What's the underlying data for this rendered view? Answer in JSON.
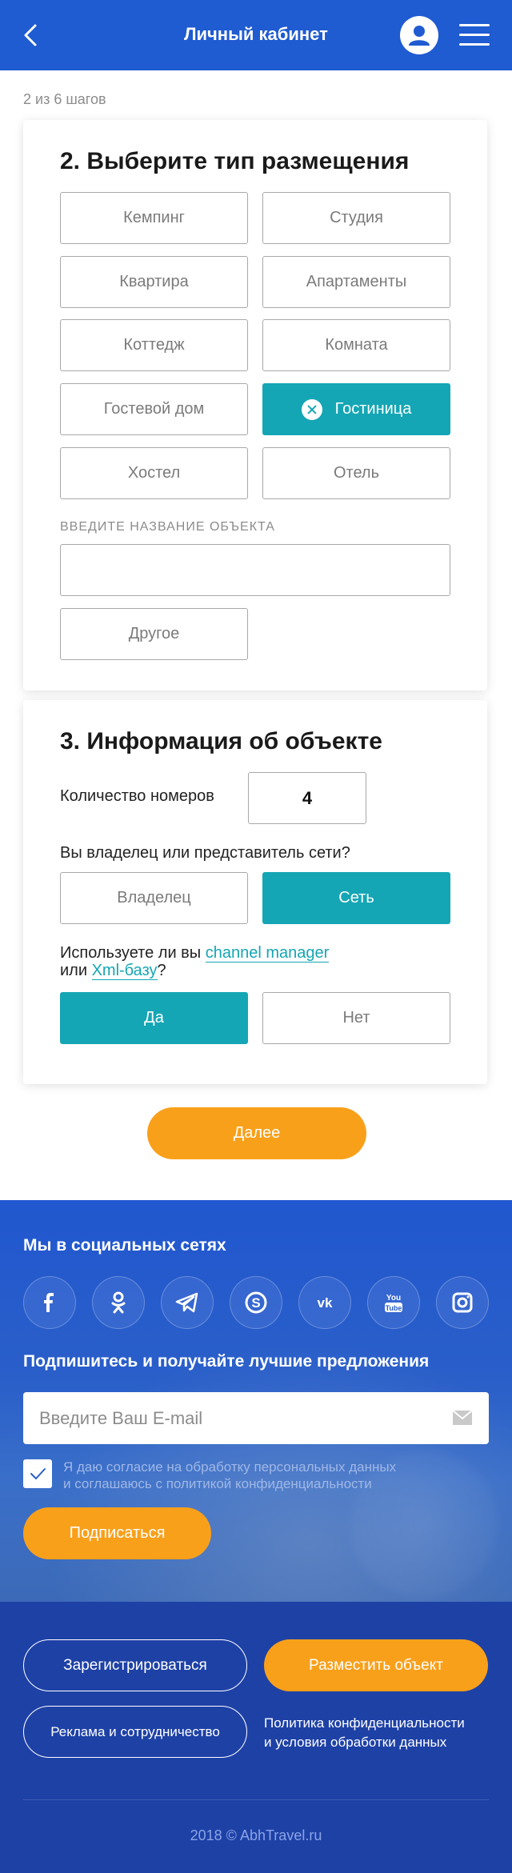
{
  "header": {
    "title": "Личный кабинет"
  },
  "progress": {
    "text": "2 из 6 шагов"
  },
  "section2": {
    "title": "2. Выберите тип размещения",
    "options": [
      "Кемпинг",
      "Студия",
      "Квартира",
      "Апартаменты",
      "Коттедж",
      "Комната",
      "Гостевой дом",
      "Гостиница",
      "Хостел",
      "Отель"
    ],
    "selected": "Гостиница",
    "name_label": "ВВЕДИТЕ НАЗВАНИЕ ОБЪЕКТА",
    "name_value": "",
    "other_label": "Другое"
  },
  "section3": {
    "title": "3. Информация об объекте",
    "rooms_label": "Количество номеров",
    "rooms_value": "4",
    "owner_question": "Вы владелец или представитель сети?",
    "owner_options": [
      "Владелец",
      "Сеть"
    ],
    "owner_selected": "Сеть",
    "cm_prefix": "Используете ли вы",
    "cm_link": "channel manager",
    "cm_or": "или",
    "xml_link": "Xml-базу",
    "cm_suffix": "?",
    "cm_options": [
      "Да",
      "Нет"
    ],
    "cm_selected": "Да"
  },
  "next_label": "Далее",
  "footer": {
    "social_title": "Мы в социальных сетях",
    "social_icons": [
      "facebook-icon",
      "odnoklassniki-icon",
      "telegram-icon",
      "skype-icon",
      "vk-icon",
      "youtube-icon",
      "instagram-icon"
    ],
    "subscribe_title": "Подпишитесь и получайте лучшие предложения",
    "email_placeholder": "Введите Ваш E-mail",
    "consent_line1": "Я даю согласие на обработку персональных данных",
    "consent_line2": "и соглашаюсь с политикой конфиденциальности",
    "consent_checked": true,
    "subscribe_label": "Подписаться",
    "register_label": "Зарегистрироваться",
    "place_label": "Разместить объект",
    "ads_label": "Реклама и сотрудничество",
    "policy_line1": "Политика конфиденциальности",
    "policy_line2": "и условия обработки данных",
    "copyright": "2018 © AbhTravel.ru"
  },
  "colors": {
    "header": "#1f5bd1",
    "accent": "#14a6b4",
    "orange": "#f9a01b",
    "footer_dark": "#1e41a6"
  }
}
